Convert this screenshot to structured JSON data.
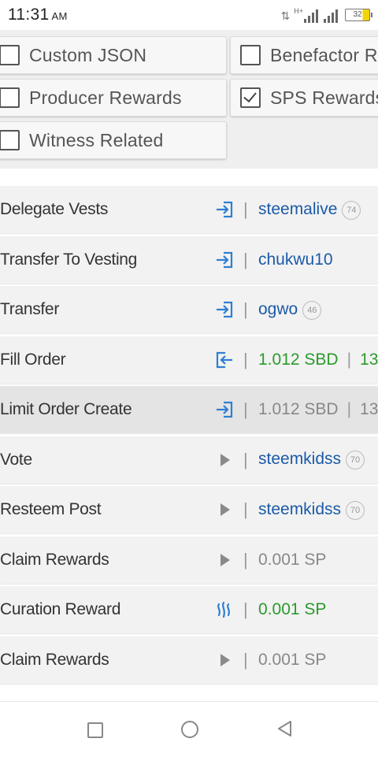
{
  "status": {
    "time": "11:31",
    "ampm": "AM",
    "network": "H+",
    "battery": "32"
  },
  "filters": [
    {
      "label": "Custom JSON",
      "checked": false
    },
    {
      "label": "Benefactor Rewards",
      "checked": false
    },
    {
      "label": "Producer Rewards",
      "checked": false
    },
    {
      "label": "SPS Rewards",
      "checked": true
    },
    {
      "label": "Witness Related",
      "checked": false
    }
  ],
  "operations": [
    {
      "name": "Delegate Vests",
      "icon": "arrow-in-icon",
      "value": "steemalive",
      "rep": "74",
      "style": "blue"
    },
    {
      "name": "Transfer To Vesting",
      "icon": "arrow-in-icon",
      "value": "chukwu10",
      "style": "blue"
    },
    {
      "name": "Transfer",
      "icon": "arrow-in-icon",
      "value": "ogwo",
      "rep": "46",
      "style": "blue"
    },
    {
      "name": "Fill Order",
      "icon": "arrow-out-icon",
      "value": "1.012 SBD",
      "extra": "13",
      "style": "green"
    },
    {
      "name": "Limit Order Create",
      "icon": "arrow-in-icon",
      "value": "1.012 SBD",
      "extra": "13",
      "style": "grey",
      "highlight": true
    },
    {
      "name": "Vote",
      "icon": "play-icon",
      "value": "steemkidss",
      "rep": "70",
      "style": "blue"
    },
    {
      "name": "Resteem Post",
      "icon": "play-icon",
      "value": "steemkidss",
      "rep": "70",
      "style": "blue"
    },
    {
      "name": "Claim Rewards",
      "icon": "play-icon",
      "value": "0.001 SP",
      "style": "grey"
    },
    {
      "name": "Curation Reward",
      "icon": "steem-icon",
      "value": "0.001 SP",
      "style": "green"
    },
    {
      "name": "Claim Rewards",
      "icon": "play-icon",
      "value": "0.001 SP",
      "style": "grey"
    }
  ],
  "colors": {
    "link_blue": "#1b5aa8",
    "value_green": "#2a9a2a",
    "icon_blue": "#2f7fd1"
  }
}
